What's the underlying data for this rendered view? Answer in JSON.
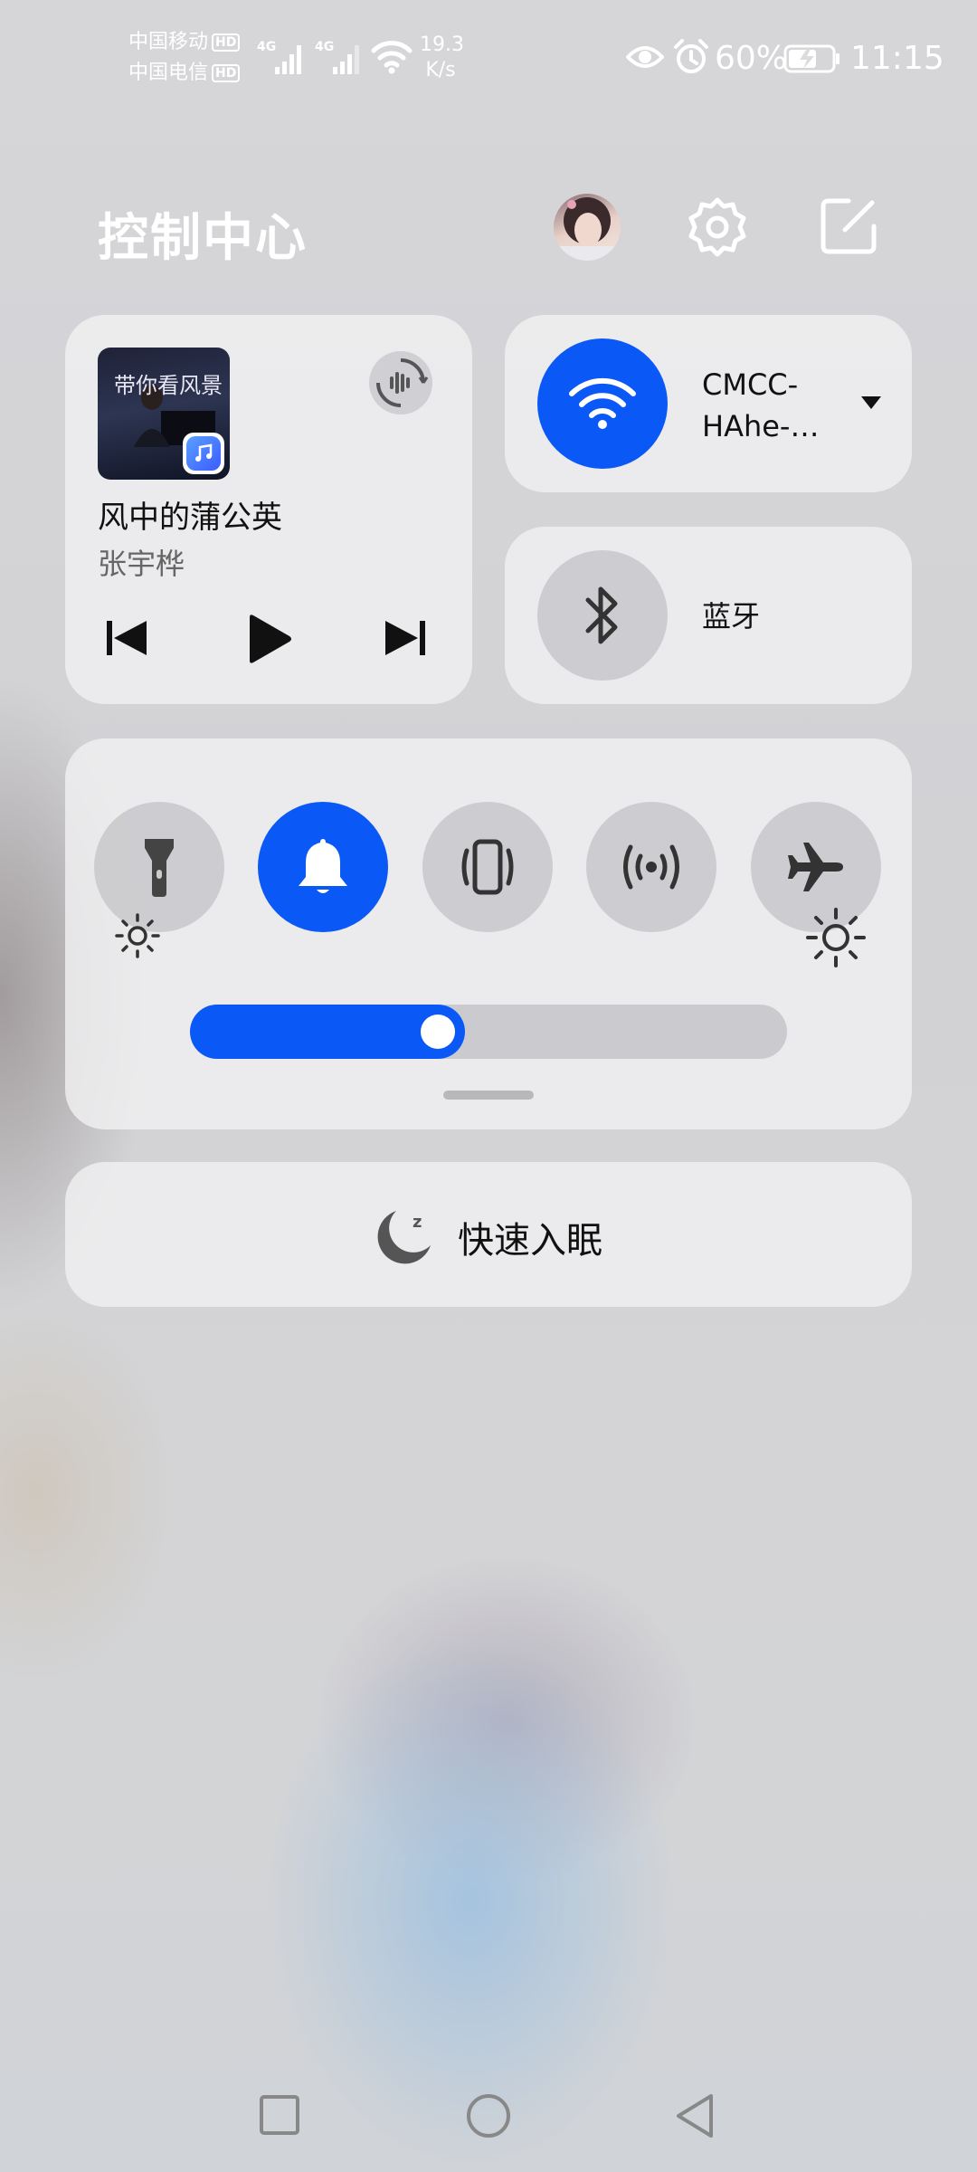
{
  "status_bar": {
    "carrier1": "中国移动",
    "carrier2": "中国电信",
    "hd1": "HD",
    "hd2": "HD",
    "net1": "4G",
    "net2": "4G",
    "speed_value": "19.3",
    "speed_unit": "K/s",
    "battery": "60%",
    "time": "11:15"
  },
  "header": {
    "title": "控制中心"
  },
  "music": {
    "song": "风中的蒲公英",
    "artist": "张宇桦",
    "album_text": "带你看风景"
  },
  "wifi": {
    "name_line1": "CMCC-",
    "name_line2": "HAhe-…"
  },
  "bluetooth": {
    "label": "蓝牙"
  },
  "toggles": [
    "flashlight-icon",
    "bell-icon",
    "vibrate-icon",
    "hotspot-icon",
    "airplane-icon"
  ],
  "brightness": {
    "level_percent": 46
  },
  "sleep": {
    "label": "快速入眠"
  },
  "colors": {
    "accent": "#0a59f7",
    "tile_bg": "#f0f0f2",
    "icon_dark": "#333333"
  }
}
